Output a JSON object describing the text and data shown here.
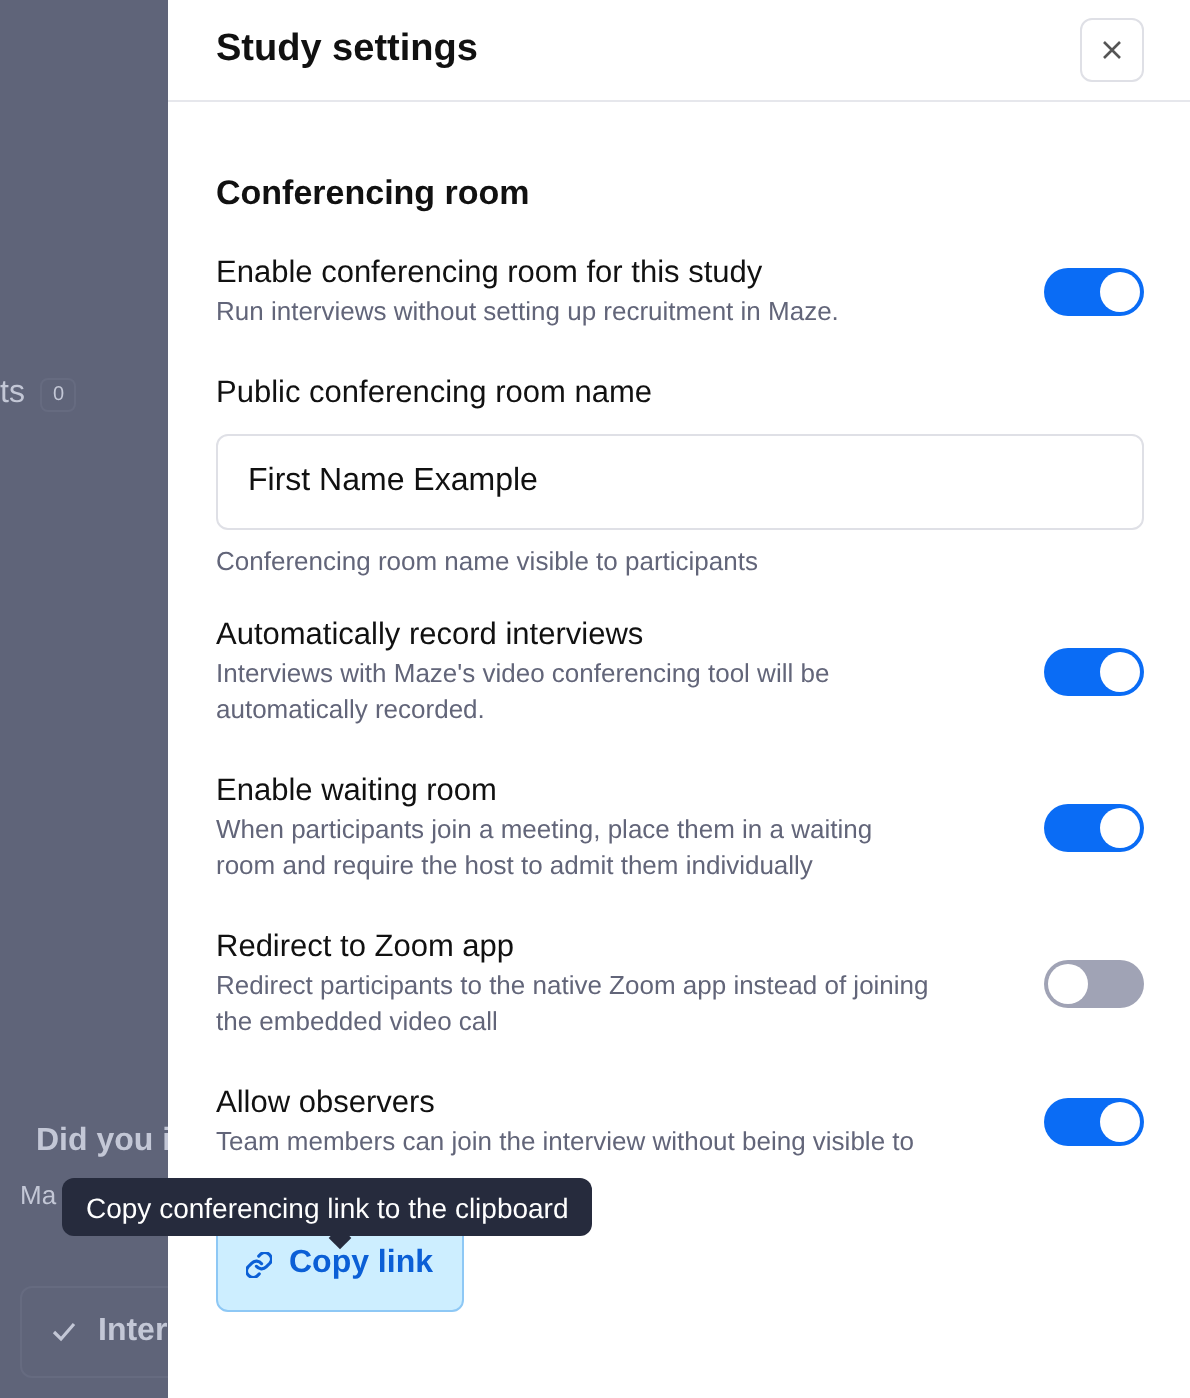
{
  "background": {
    "heading_fragment": "ts",
    "count_badge": "0",
    "notice_title": "Did you i",
    "notice_text": "Ma",
    "action_button": "Inter"
  },
  "panel": {
    "title": "Study settings"
  },
  "section": {
    "title": "Conferencing room"
  },
  "settings": [
    {
      "kind": "toggle",
      "label": "Enable conferencing room for this study",
      "description": "Run interviews without setting up recruitment in Maze.",
      "on": true
    },
    {
      "kind": "field",
      "label": "Public conferencing room name",
      "value": "First Name Example",
      "hint": "Conferencing room name visible to participants"
    },
    {
      "kind": "toggle",
      "label": "Automatically record interviews",
      "description": "Interviews with Maze's video conferencing tool will be automatically recorded.",
      "on": true
    },
    {
      "kind": "toggle",
      "label": "Enable waiting room",
      "description": "When participants join a meeting, place them in a waiting room and require the host to admit them individually",
      "on": true
    },
    {
      "kind": "toggle",
      "label": "Redirect to Zoom app",
      "description": "Redirect participants to the native Zoom app instead of joining the embedded video call",
      "on": false
    },
    {
      "kind": "toggle",
      "label": "Allow observers",
      "description": "Team members can join the interview without being visible to",
      "on": true
    }
  ],
  "copy_button": {
    "label": "Copy link"
  },
  "tooltip": {
    "text": "Copy conferencing link to the clipboard"
  }
}
